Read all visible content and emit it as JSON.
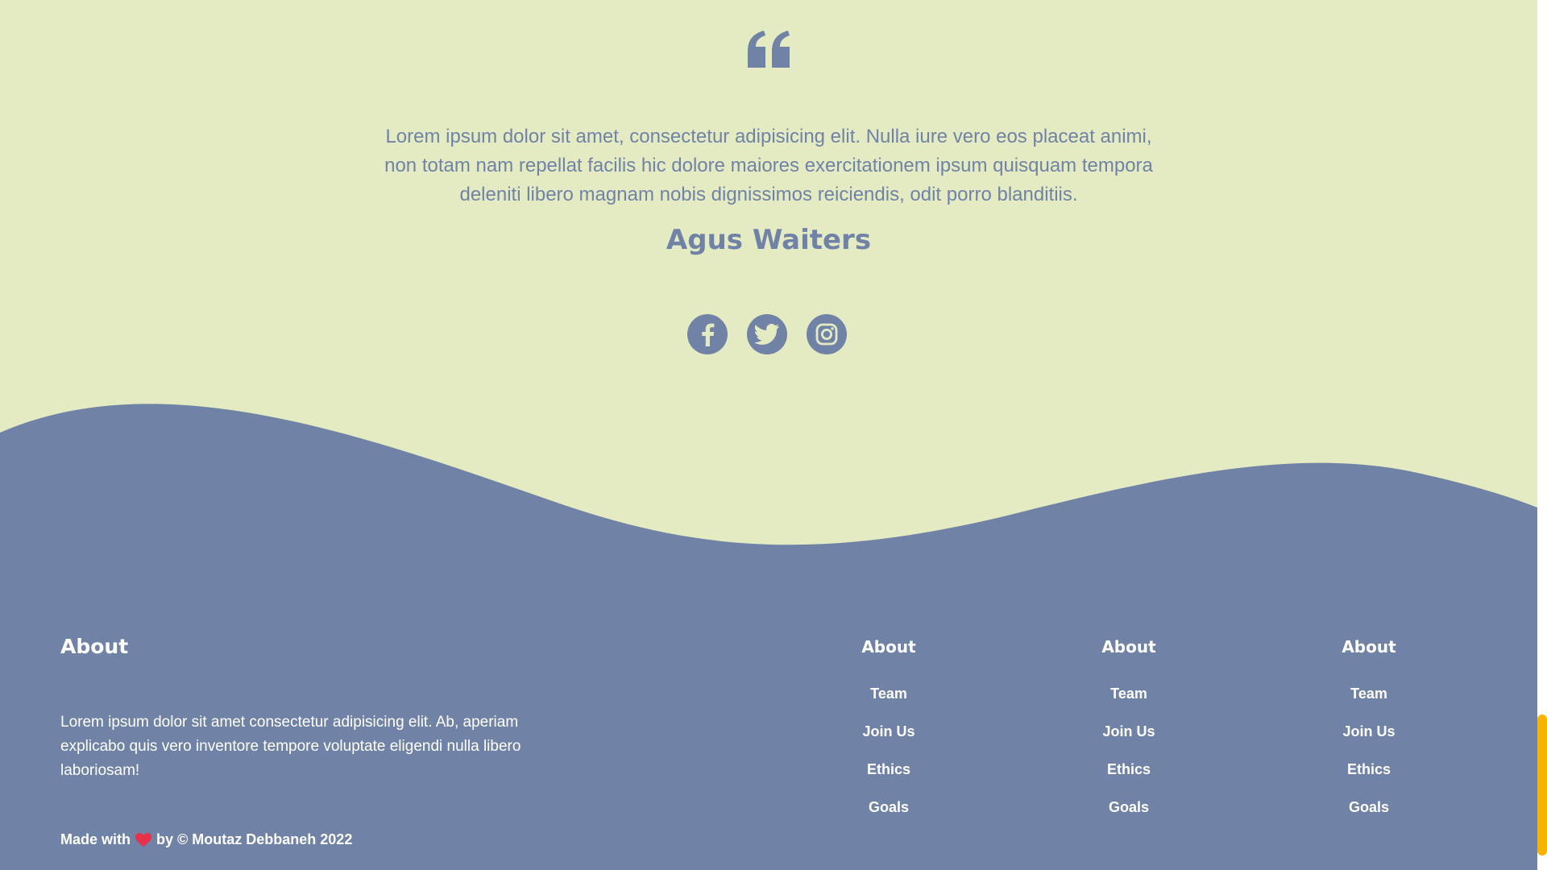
{
  "testimonial": {
    "quote_icon": "quote-icon",
    "text": "Lorem ipsum dolor sit amet, consectetur adipisicing elit. Nulla iure vero eos placeat animi, non totam nam repellat facilis hic dolore maiores exercitationem ipsum quisquam tempora deleniti libero magnam nobis dignissimos reiciendis, odit porro blanditiis.",
    "author": "Agus Waiters",
    "socials": [
      {
        "icon": "facebook-icon"
      },
      {
        "icon": "twitter-icon"
      },
      {
        "icon": "instagram-icon"
      }
    ]
  },
  "footer": {
    "about": {
      "title": "About",
      "text": "Lorem ipsum dolor sit amet consectetur adipisicing elit. Ab, aperiam explicabo quis vero inventore tempore voluptate eligendi nulla libero laboriosam!"
    },
    "columns": [
      {
        "title": "About",
        "links": [
          "Team",
          "Join Us",
          "Ethics",
          "Goals"
        ]
      },
      {
        "title": "About",
        "links": [
          "Team",
          "Join Us",
          "Ethics",
          "Goals"
        ]
      },
      {
        "title": "About",
        "links": [
          "Team",
          "Join Us",
          "Ethics",
          "Goals"
        ]
      }
    ],
    "made_with_prefix": "Made with",
    "heart_icon": "heart-icon",
    "made_with_suffix": "by © Moutaz Debbaneh 2022"
  },
  "colors": {
    "background": "#e4ebc2",
    "accent": "#7083a6",
    "scrollbar_thumb": "#f4b400",
    "heart": "#e8304a"
  }
}
